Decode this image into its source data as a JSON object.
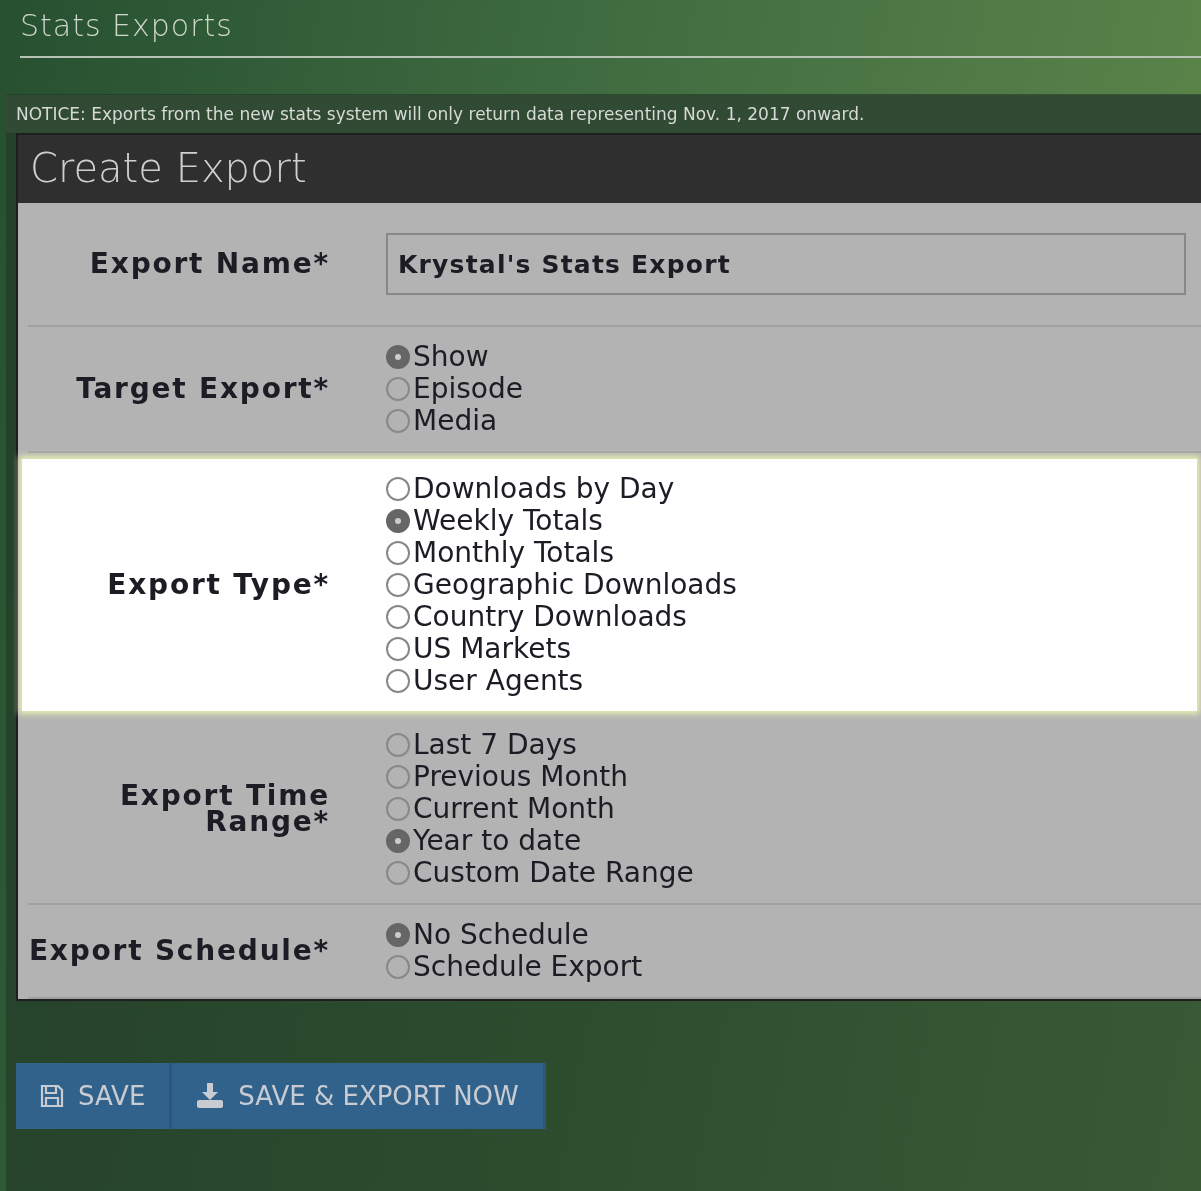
{
  "page_title": "Stats Exports",
  "notice": "NOTICE: Exports from the new stats system will only return data representing Nov. 1, 2017 onward.",
  "panel": {
    "title": "Create Export",
    "fields": [
      {
        "kind": "text",
        "label": "Export Name*",
        "value": "Krystal's Stats Export",
        "highlighted": false
      },
      {
        "kind": "radio",
        "label": "Target Export*",
        "highlighted": false,
        "options": [
          {
            "label": "Show",
            "selected": true
          },
          {
            "label": "Episode",
            "selected": false
          },
          {
            "label": "Media",
            "selected": false
          }
        ]
      },
      {
        "kind": "radio",
        "label": "Export Type*",
        "highlighted": true,
        "options": [
          {
            "label": "Downloads by Day",
            "selected": false
          },
          {
            "label": "Weekly Totals",
            "selected": true
          },
          {
            "label": "Monthly Totals",
            "selected": false
          },
          {
            "label": "Geographic Downloads",
            "selected": false
          },
          {
            "label": "Country Downloads",
            "selected": false
          },
          {
            "label": "US Markets",
            "selected": false
          },
          {
            "label": "User Agents",
            "selected": false
          }
        ]
      },
      {
        "kind": "radio",
        "label": "Export Time Range*",
        "highlighted": false,
        "options": [
          {
            "label": "Last 7 Days",
            "selected": false
          },
          {
            "label": "Previous Month",
            "selected": false
          },
          {
            "label": "Current Month",
            "selected": false
          },
          {
            "label": "Year to date",
            "selected": true
          },
          {
            "label": "Custom Date Range",
            "selected": false
          }
        ]
      },
      {
        "kind": "radio",
        "label": "Export Schedule*",
        "highlighted": false,
        "options": [
          {
            "label": "No Schedule",
            "selected": true
          },
          {
            "label": "Schedule Export",
            "selected": false
          }
        ]
      }
    ]
  },
  "buttons": [
    {
      "kind": "save",
      "label": "SAVE"
    },
    {
      "kind": "export",
      "label": "SAVE & EXPORT NOW"
    }
  ]
}
